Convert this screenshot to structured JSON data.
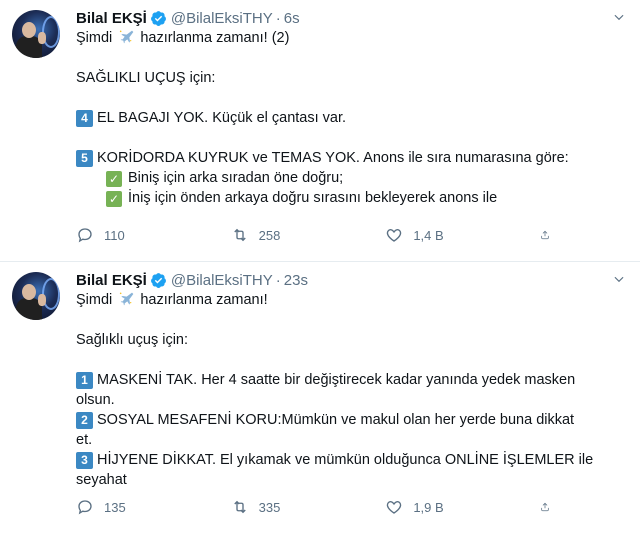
{
  "tweets": [
    {
      "author": "Bilal EKŞİ",
      "handle": "@BilalEksiTHY",
      "separator": "·",
      "time": "6s",
      "lines": {
        "l1_pre": "Şimdi",
        "l1_post": "hazırlanma zamanı! (2)",
        "l2": "SAĞLIKLI UÇUŞ için:",
        "item4_num": "4",
        "item4": "EL BAGAJI YOK. Küçük el çantası var.",
        "item5_num": "5",
        "item5": "KORİDORDA KUYRUK ve TEMAS YOK. Anons ile sıra numarasına göre:",
        "check1": "Biniş için arka sıradan öne doğru;",
        "check2": "İniş için önden arkaya doğru sırasını bekleyerek anons ile"
      },
      "replies": "110",
      "retweets": "258",
      "likes": "1,4 B"
    },
    {
      "author": "Bilal EKŞİ",
      "handle": "@BilalEksiTHY",
      "separator": "·",
      "time": "23s",
      "lines": {
        "l1_pre": "Şimdi",
        "l1_post": "hazırlanma zamanı!",
        "l2": "Sağlıklı uçuş için:",
        "item1_num": "1",
        "item1a": "MASKENİ TAK. Her 4 saatte bir değiştirecek kadar yanında yedek masken",
        "item1b": "olsun.",
        "item2_num": "2",
        "item2a": "SOSYAL MESAFENİ KORU:Mümkün ve makul  olan her yerde buna dikkat",
        "item2b": "et.",
        "item3_num": "3",
        "item3a": "HİJYENE DİKKAT. El yıkamak ve mümkün olduğunca  ONLİNE İŞLEMLER ile",
        "item3b": "seyahat"
      },
      "replies": "135",
      "retweets": "335",
      "likes": "1,9 B"
    }
  ],
  "icons": {
    "verified": "verified-badge-icon",
    "plane": "airplane-sparkle-emoji",
    "reply": "reply-icon",
    "retweet": "retweet-icon",
    "like": "heart-icon",
    "share": "share-icon",
    "caret": "chevron-down-icon"
  },
  "colors": {
    "verified": "#1da1f2",
    "secondary_text": "#5b7083",
    "keycap": "#3b88c3",
    "checkmark": "#77b255"
  }
}
